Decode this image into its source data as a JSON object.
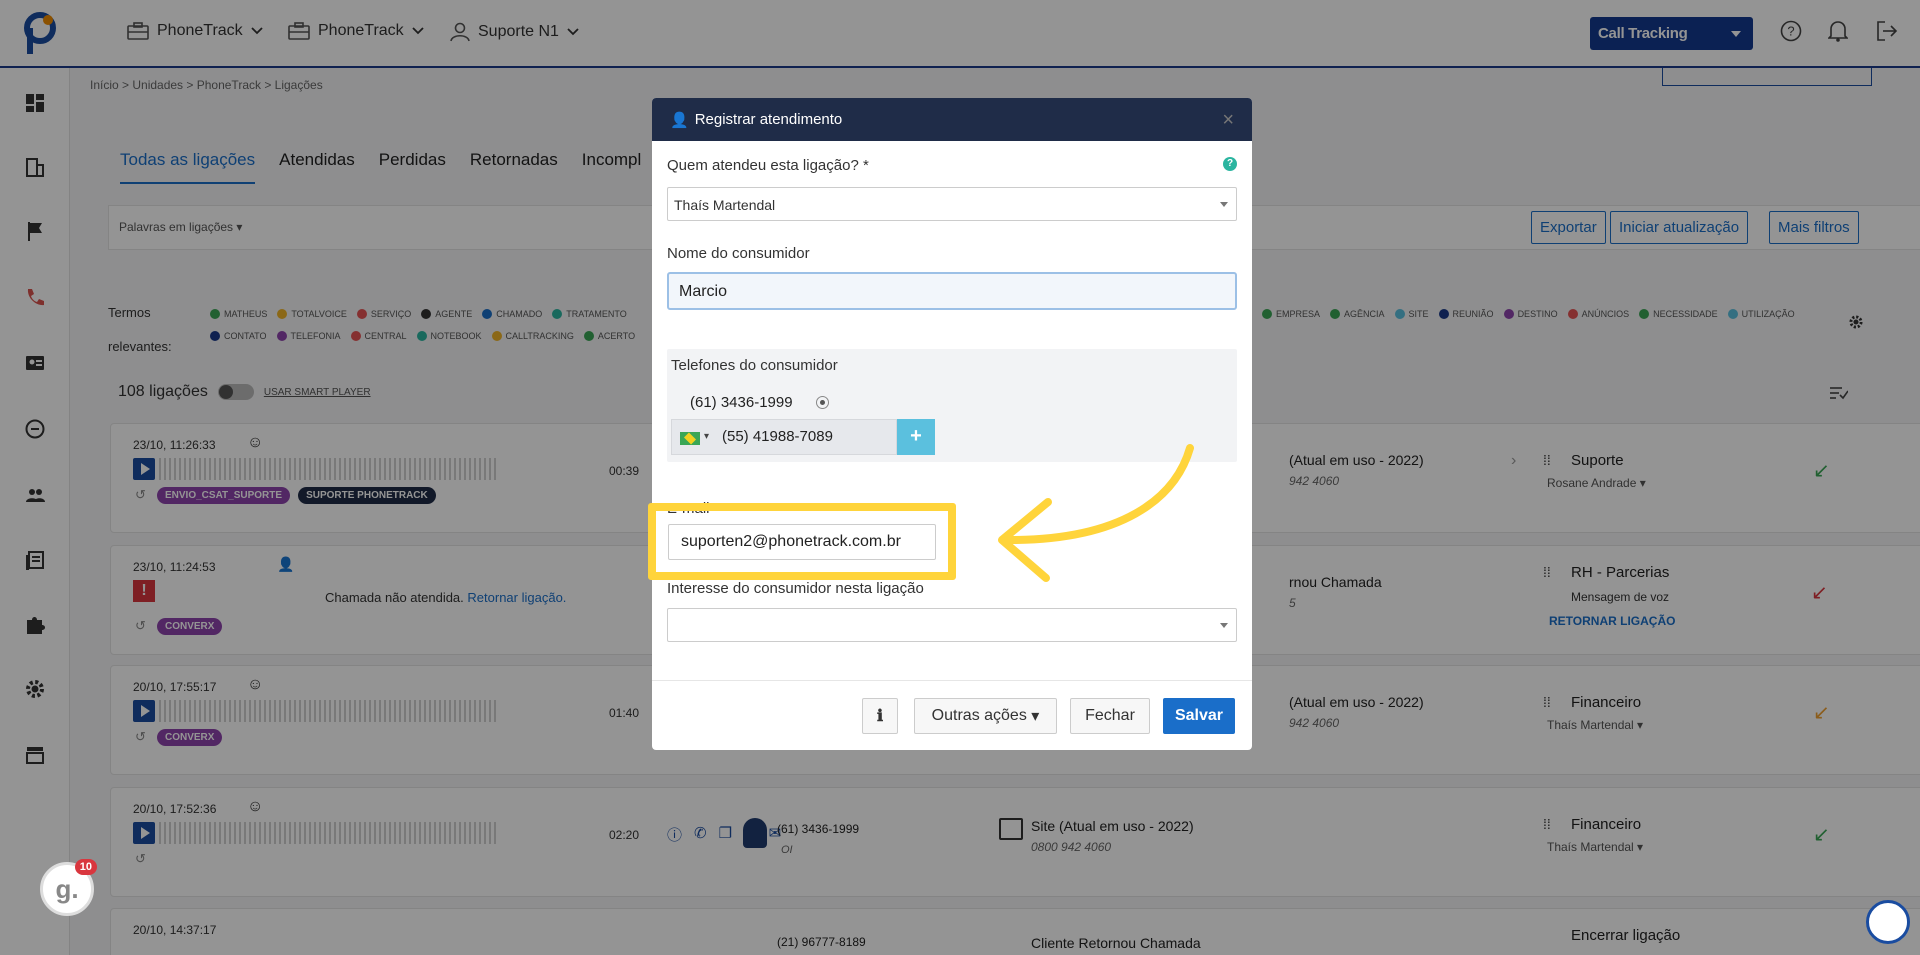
{
  "topbar": {
    "nav": [
      {
        "label": "PhoneTrack"
      },
      {
        "label": "PhoneTrack"
      },
      {
        "label": "Suporte N1"
      }
    ],
    "call_tracking": "Call Tracking"
  },
  "breadcrumb": "Início  >  Unidades  >  PhoneTrack  >  Ligações",
  "tabs": [
    "Todas as ligações",
    "Atendidas",
    "Perdidas",
    "Retornadas",
    "Incompl"
  ],
  "filters": {
    "keywords_select": "Palavras em ligações",
    "export": "Exportar",
    "start_update": "Iniciar atualização",
    "more_filters": "Mais filtros"
  },
  "terms": {
    "label_1": "Termos",
    "label_2": "relevantes:",
    "row1": [
      "MATHEUS",
      "TOTALVOICE",
      "SERVIÇO",
      "AGENTE",
      "CHAMADO",
      "TRATAMENTO"
    ],
    "row1_right": [
      "EMPRESA",
      "AGÊNCIA",
      "SITE",
      "REUNIÃO",
      "DESTINO",
      "ANÚNCIOS",
      "NECESSIDADE",
      "UTILIZAÇÃO"
    ],
    "row2": [
      "CONTATO",
      "TELEFONIA",
      "CENTRAL",
      "NOTEBOOK",
      "CALLTRACKING",
      "ACERTO"
    ]
  },
  "list": {
    "count": "108 ligações",
    "smart_player": "USAR SMART PLAYER"
  },
  "cards": [
    {
      "date": "23/10, 11:26:33",
      "duration": "00:39",
      "tags": [
        "ENVIO_CSAT_SUPORTE",
        "SUPORTE PHONETRACK"
      ],
      "mid": "(Atual em uso - 2022)",
      "mid_sub": "942 4060",
      "dest": "Suporte",
      "agent": "Rosane Andrade"
    },
    {
      "date": "23/10, 11:24:53",
      "missed_text": "Chamada não atendida.",
      "missed_link": "Retornar ligação.",
      "tags": [
        "CONVERX"
      ],
      "mid": "rnou Chamada",
      "mid_sub": "5",
      "dest": "RH - Parcerias",
      "agent": "Mensagem de voz",
      "return_link": "RETORNAR LIGAÇÃO"
    },
    {
      "date": "20/10, 17:55:17",
      "duration": "01:40",
      "tags": [
        "CONVERX"
      ],
      "mid": "(Atual em uso - 2022)",
      "mid_sub": "942 4060",
      "dest": "Financeiro",
      "agent": "Thaís Martendal"
    },
    {
      "date": "20/10, 17:52:36",
      "duration": "02:20",
      "tags": [],
      "phone": "(61) 3436-1999",
      "phone_sub": "OI",
      "mid": "Site (Atual em uso - 2022)",
      "mid_sub": "0800 942 4060",
      "dest": "Financeiro",
      "agent": "Thaís Martendal"
    },
    {
      "date": "20/10, 14:37:17",
      "phone": "(21) 96777-8189",
      "mid": "Cliente Retornou Chamada",
      "dest": "Encerrar ligação"
    }
  ],
  "modal": {
    "title": "Registrar atendimento",
    "who_label": "Quem atendeu esta ligação? *",
    "who_value": "Thaís Martendal",
    "name_label": "Nome do consumidor",
    "name_value": "Marcio",
    "phones_label": "Telefones do consumidor",
    "phone_1": "(61) 3436-1999",
    "phone_2": "(55) 41988-7089",
    "email_label": "E-mail",
    "email_value": "suporten2@phonetrack.com.br",
    "interest_label": "Interesse do consumidor nesta ligação",
    "other_actions": "Outras ações",
    "close": "Fechar",
    "save": "Salvar"
  },
  "badge_count": "10",
  "colors": {
    "brand": "#14398f",
    "accent": "#1a6ec9",
    "highlight": "#ffd43b"
  }
}
